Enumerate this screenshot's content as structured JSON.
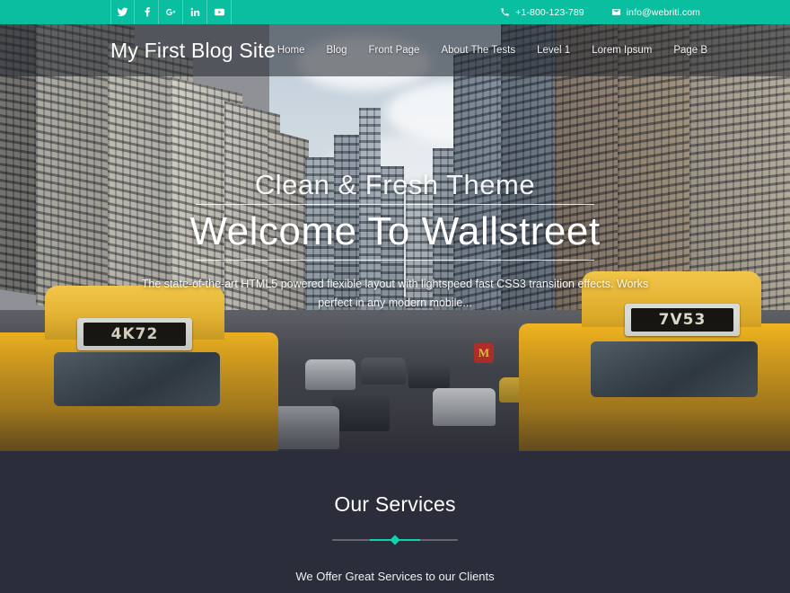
{
  "topbar": {
    "social": [
      {
        "name": "twitter-icon",
        "label": "Twitter"
      },
      {
        "name": "facebook-icon",
        "label": "Facebook"
      },
      {
        "name": "google-plus-icon",
        "label": "Google Plus"
      },
      {
        "name": "linkedin-icon",
        "label": "LinkedIn"
      },
      {
        "name": "youtube-icon",
        "label": "YouTube"
      }
    ],
    "phone": "+1-800-123-789",
    "email": "info@webriti.com",
    "phone_icon": "phone-icon",
    "email_icon": "envelope-icon",
    "background_color": "#0abfa0"
  },
  "header": {
    "site_title": "My First Blog Site",
    "nav": [
      {
        "label": "Home"
      },
      {
        "label": "Blog"
      },
      {
        "label": "Front Page"
      },
      {
        "label": "About The Tests"
      },
      {
        "label": "Level 1"
      },
      {
        "label": "Lorem Ipsum"
      },
      {
        "label": "Page B"
      }
    ]
  },
  "hero": {
    "subtitle": "Clean & Fresh Theme",
    "title": "Welcome To Wallstreet",
    "description": "The state-of-the-art HTML5 powered flexible layout with lightspeed fast CSS3 transition effects. Works perfect in any modern mobile...",
    "scene": {
      "left_taxi_medallion": "4K72",
      "right_taxi_medallion": "7V53",
      "storefront_sign": "M"
    }
  },
  "services": {
    "title": "Our Services",
    "subtitle": "We Offer Great Services to our Clients",
    "accent_color": "#0dd3ae",
    "background_color": "#2b2e3a"
  }
}
